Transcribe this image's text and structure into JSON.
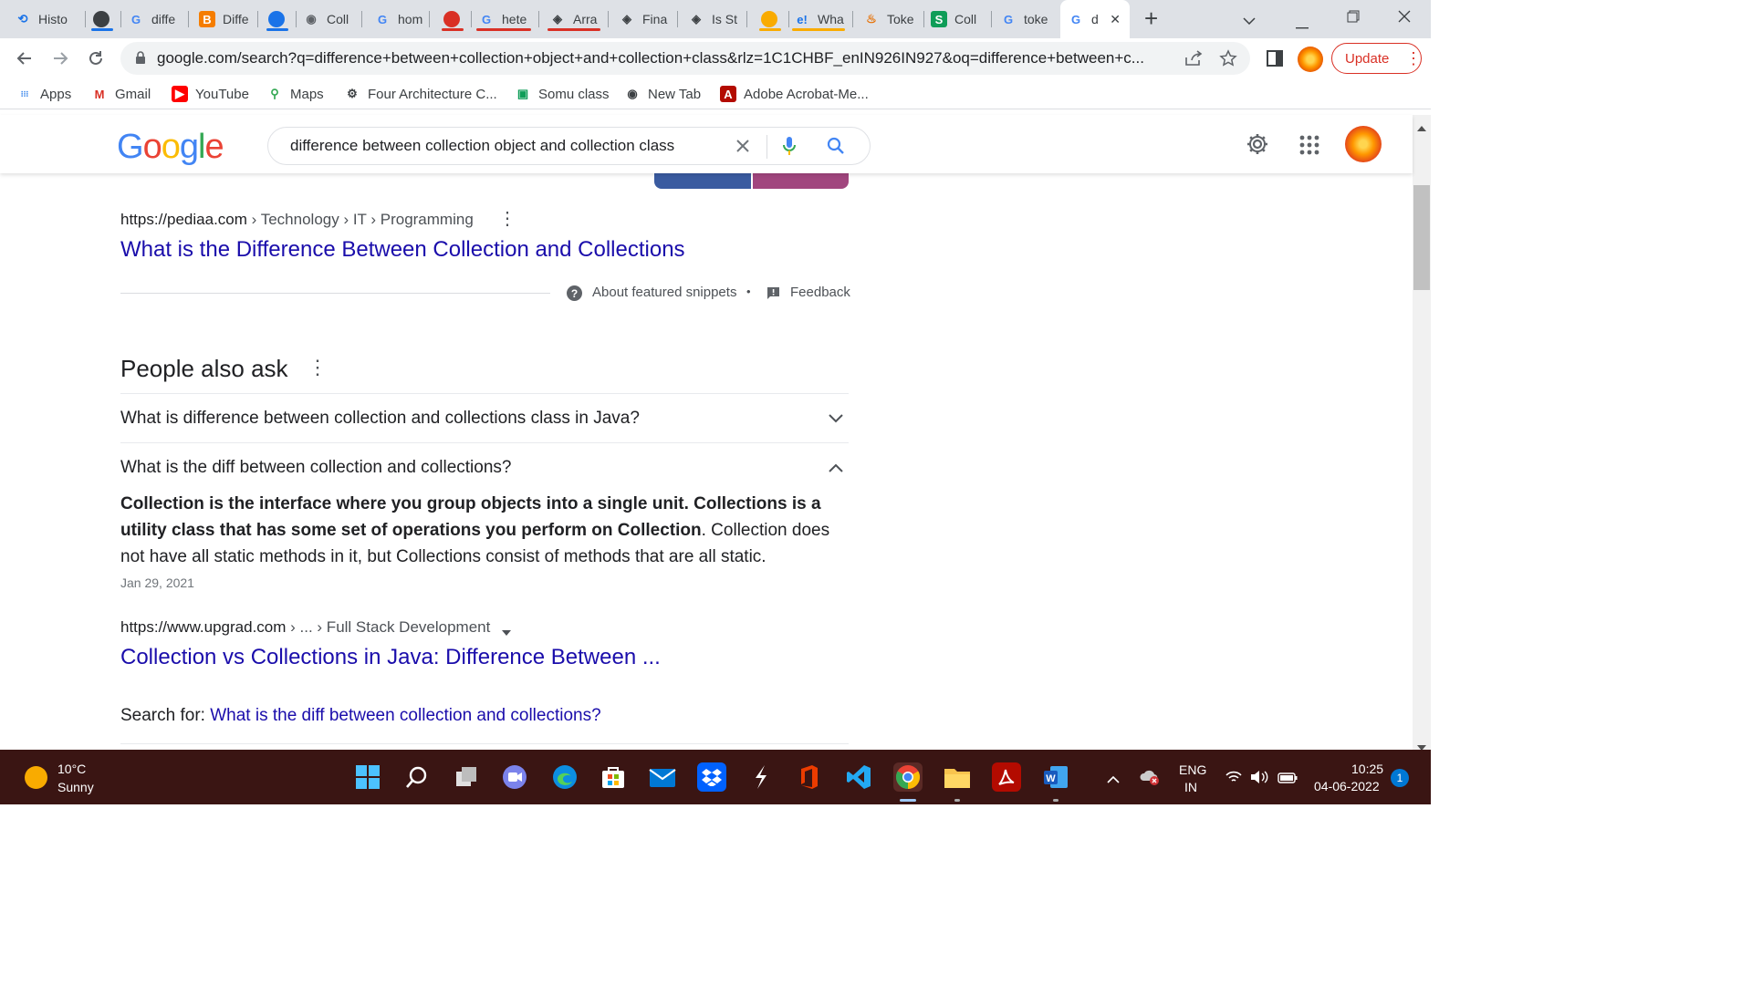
{
  "tabs": [
    {
      "label": "Histo",
      "icon": "history-icon",
      "color": "#1a73e8"
    },
    {
      "label": "",
      "icon": "circle-icon",
      "color": "#3c4043"
    },
    {
      "label": "diffe",
      "icon": "google-icon",
      "color": "#4285f4"
    },
    {
      "label": "Diffe",
      "icon": "blogger-icon",
      "color": "#f57d00"
    },
    {
      "label": "",
      "icon": "circle-icon",
      "color": "#1a73e8"
    },
    {
      "label": "Coll",
      "icon": "globe-icon",
      "color": "#5f6368"
    },
    {
      "label": "hom",
      "icon": "google-icon",
      "color": "#4285f4"
    },
    {
      "label": "",
      "icon": "circle-icon",
      "color": "#d93025"
    },
    {
      "label": "hete",
      "icon": "google-icon",
      "color": "#4285f4"
    },
    {
      "label": "Arra",
      "icon": "diamond-icon",
      "color": "#3c4043"
    },
    {
      "label": "Fina",
      "icon": "diamond-icon",
      "color": "#3c4043"
    },
    {
      "label": "Is St",
      "icon": "diamond-icon",
      "color": "#3c4043"
    },
    {
      "label": "",
      "icon": "circle-icon",
      "color": "#f9ab00"
    },
    {
      "label": "Wha",
      "icon": "e-icon",
      "color": "#1a73e8"
    },
    {
      "label": "Toke",
      "icon": "java-icon",
      "color": "#e76f00"
    },
    {
      "label": "Coll",
      "icon": "s-icon",
      "color": "#0f9d58"
    },
    {
      "label": "toke",
      "icon": "google-icon",
      "color": "#4285f4"
    },
    {
      "label": "d",
      "icon": "google-icon",
      "color": "#4285f4"
    }
  ],
  "new_tab_label": "+",
  "address": {
    "url": "google.com/search?q=difference+between+collection+object+and+collection+class&rlz=1C1CHBF_enIN926IN927&oq=difference+between+c..."
  },
  "update_label": "Update",
  "bookmarks": [
    {
      "label": "Apps",
      "icon": "apps-icon",
      "color": "#1a73e8"
    },
    {
      "label": "Gmail",
      "icon": "gmail-icon",
      "color": "#d93025"
    },
    {
      "label": "YouTube",
      "icon": "youtube-icon",
      "color": "#ff0000"
    },
    {
      "label": "Maps",
      "icon": "maps-icon",
      "color": "#34a853"
    },
    {
      "label": "Four Architecture C...",
      "icon": "bike-icon",
      "color": "#3c4043"
    },
    {
      "label": "Somu class",
      "icon": "classroom-icon",
      "color": "#0f9d58"
    },
    {
      "label": "New Tab",
      "icon": "globe-icon",
      "color": "#3c4043"
    },
    {
      "label": "Adobe Acrobat-Me...",
      "icon": "acrobat-icon",
      "color": "#b30b00"
    }
  ],
  "google": {
    "logo": [
      "G",
      "o",
      "o",
      "g",
      "l",
      "e"
    ],
    "logo_colors": [
      "#4285f4",
      "#ea4335",
      "#fbbc05",
      "#4285f4",
      "#34a853",
      "#ea4335"
    ],
    "query": "difference between collection object and collection class"
  },
  "result1": {
    "cite_domain": "https://pediaa.com",
    "cite_path": " › Technology › IT › Programming",
    "title": "What is the Difference Between Collection and Collections"
  },
  "snippet_footer": {
    "about": "About featured snippets",
    "dot": "•",
    "feedback": "Feedback"
  },
  "paa": {
    "heading": "People also ask",
    "q1": "What is difference between collection and collections class in Java?",
    "q2": "What is the diff between collection and collections?",
    "answer_bold": "Collection is the interface where you group objects into a single unit. Collections is a utility class that has some set of operations you perform on Collection",
    "answer_rest": ". Collection does not have all static methods in it, but Collections consist of methods that are all static.",
    "date": "Jan 29, 2021",
    "cite_domain": "https://www.upgrad.com",
    "cite_path": " › ... › Full Stack Development",
    "link": "Collection vs Collections in Java: Difference Between ...",
    "search_for_label": "Search for: ",
    "search_for_link": "What is the diff between collection and collections?"
  },
  "taskbar": {
    "temp": "10°C",
    "weather": "Sunny",
    "lang_top": "ENG",
    "lang_bottom": "IN",
    "time": "10:25",
    "date": "04-06-2022",
    "notif_count": "1"
  }
}
